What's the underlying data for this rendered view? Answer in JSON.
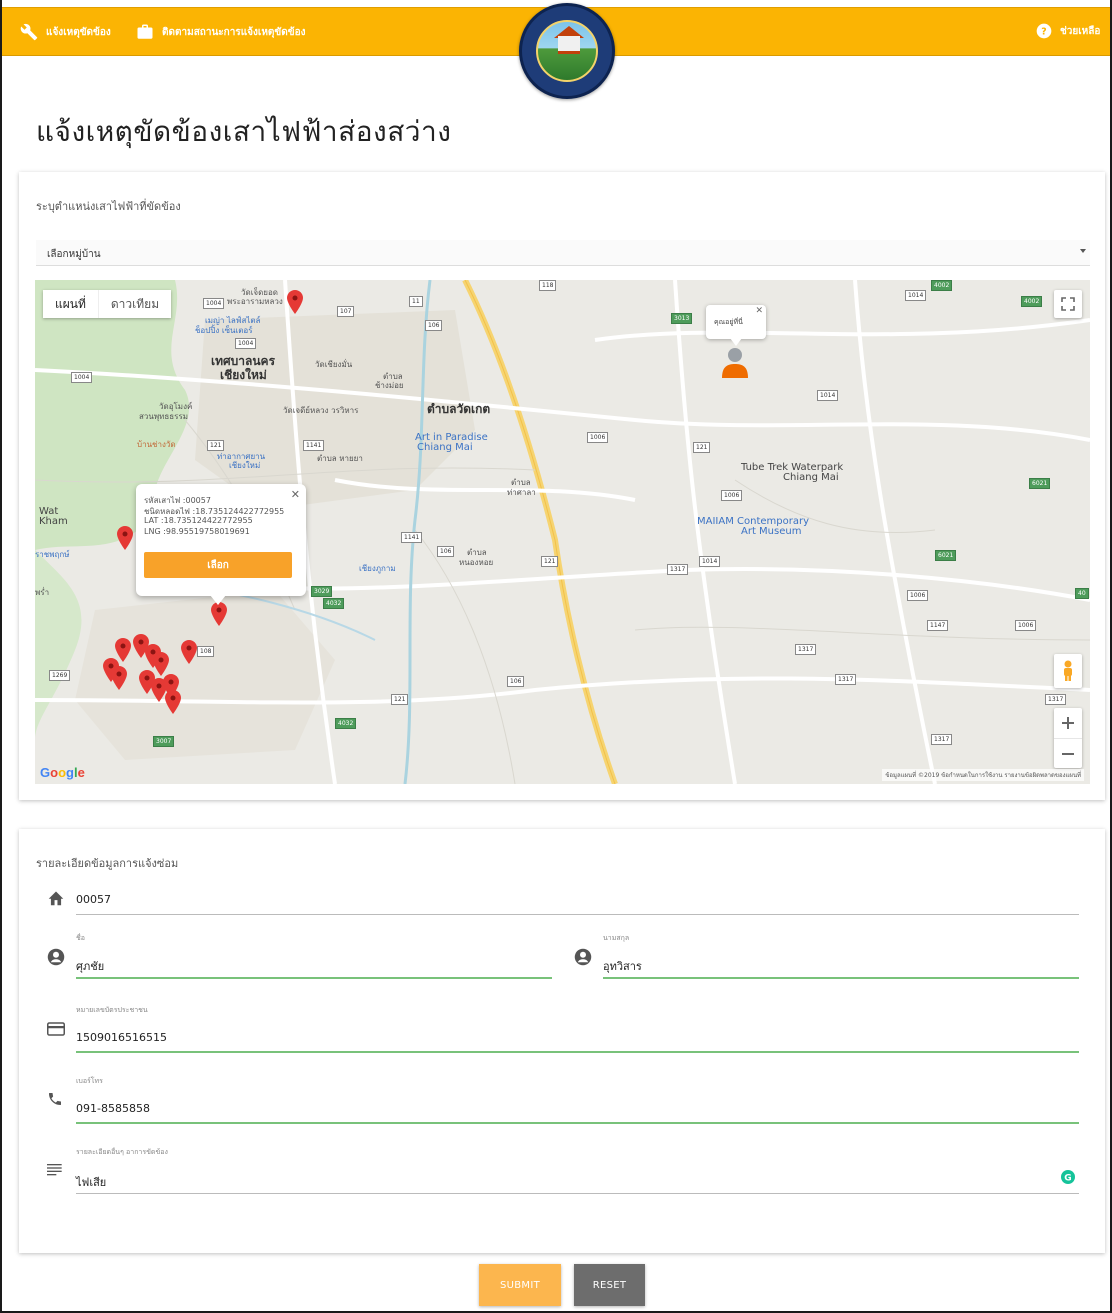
{
  "topbar": {
    "report_label": "แจ้งเหตุขัดข้อง",
    "track_label": "ติดตามสถานะการแจ้งเหตุขัดข้อง",
    "help_label": "ช่วยเหลือ",
    "accent": "#fbb403"
  },
  "page": {
    "title": "แจ้งเหตุขัดข้องเสาไฟฟ้าส่องสว่าง"
  },
  "location_card": {
    "title": "ระบุตำแหน่งเสาไฟฟ้าที่ขัดข้อง",
    "village_select": {
      "selected": "เลือกหมู่บ้าน"
    }
  },
  "map": {
    "type_map": "แผนที่",
    "type_satellite": "ดาวเทียม",
    "google": "Google",
    "footer": "ข้อมูลแผนที่ ©2019   ข้อกำหนดในการใช้งาน   รายงานข้อผิดพลาดของแผนที่",
    "labels": {
      "city": "เทศบาลนคร",
      "city2": "เชียงใหม่",
      "tambon_watket": "ตำบลวัดเกต",
      "art_paradise": "Art in Paradise",
      "art_paradise2": "Chiang Mai",
      "tube_trek": "Tube Trek Waterpark",
      "tube_trek2": "Chiang Mai",
      "maiiam": "MAIIAM Contemporary",
      "maiiam2": "Art Museum",
      "wat_kham": "Wat",
      "wat_kham2": "Kham",
      "tambon_haiya": "ตำบล หายยา",
      "tambon_nongheo": "ตำบล",
      "tambon_nongheo2": "หนองหอย",
      "tambon_thasala": "ตำบล",
      "tambon_thasala2": "ท่าศาลา",
      "tambon_changmoi": "ตำบล",
      "tambon_changmoi2": "ช้างม่อย",
      "wat_chedi": "วัดเจดีย์หลวง วรวิหาร",
      "wat_chiangman": "วัดเชียงมั่น",
      "wat_umong": "วัดอุโมงค์",
      "wat_umong2": "สวนพุทธธรรม",
      "central_festival": "เมญ่า ไลฟ์สไตล์",
      "central_festival2": "ช็อปปิ้ง เซ็นเตอร์",
      "wat_jedyod": "วัดเจ็ดยอด",
      "wat_jedyod2": "พระอารามหลวง",
      "airport": "ท่าอากาศยาน",
      "airport2": "เชียงใหม่",
      "wat_ban": "บ้านช่างวัด",
      "cemetery": "เชียงภูกาม",
      "ratchaphruek": "ราชพฤกษ์",
      "phra": "พร่ำ"
    },
    "shields": [
      "1004",
      "107",
      "106",
      "1004",
      "1004",
      "11",
      "118",
      "1141",
      "1141",
      "121",
      "1006",
      "121",
      "1014",
      "4002",
      "1014",
      "3013",
      "1006",
      "1317",
      "1014",
      "3029",
      "4032",
      "106",
      "108",
      "121",
      "1317",
      "1147",
      "1006",
      "1317",
      "1317",
      "4032",
      "121",
      "3007",
      "1269",
      "106",
      "1317",
      "6021",
      "1006",
      "6021",
      "40",
      "4002"
    ],
    "info_window": {
      "pole_code": "รหัสเสาไฟ :00057",
      "lamp_type": "ชนิดหลอดไฟ :18.735124422772955",
      "lat": "LAT :18.735124422772955",
      "lng": "LNG :98.95519758019691",
      "select_label": "เลือก"
    },
    "you_are_here": "คุณอยู่ที่นี่"
  },
  "detail_card": {
    "title": "รายละเอียดข้อมูลการแจ้งซ่อม",
    "pole_id": "00057",
    "first_name_label": "ชื่อ",
    "first_name": "ศุภชัย",
    "last_name_label": "นามสกุล",
    "last_name": "อุทวิสาร",
    "id_card_label": "หมายเลขบัตรประชาชน",
    "id_card": "1509016516515",
    "phone_label": "เบอร์โทร",
    "phone": "091-8585858",
    "detail_label": "รายละเอียดอื่นๆ อาการขัดข้อง",
    "detail": "ไฟเสีย"
  },
  "actions": {
    "submit": "SUBMIT",
    "reset": "RESET"
  }
}
